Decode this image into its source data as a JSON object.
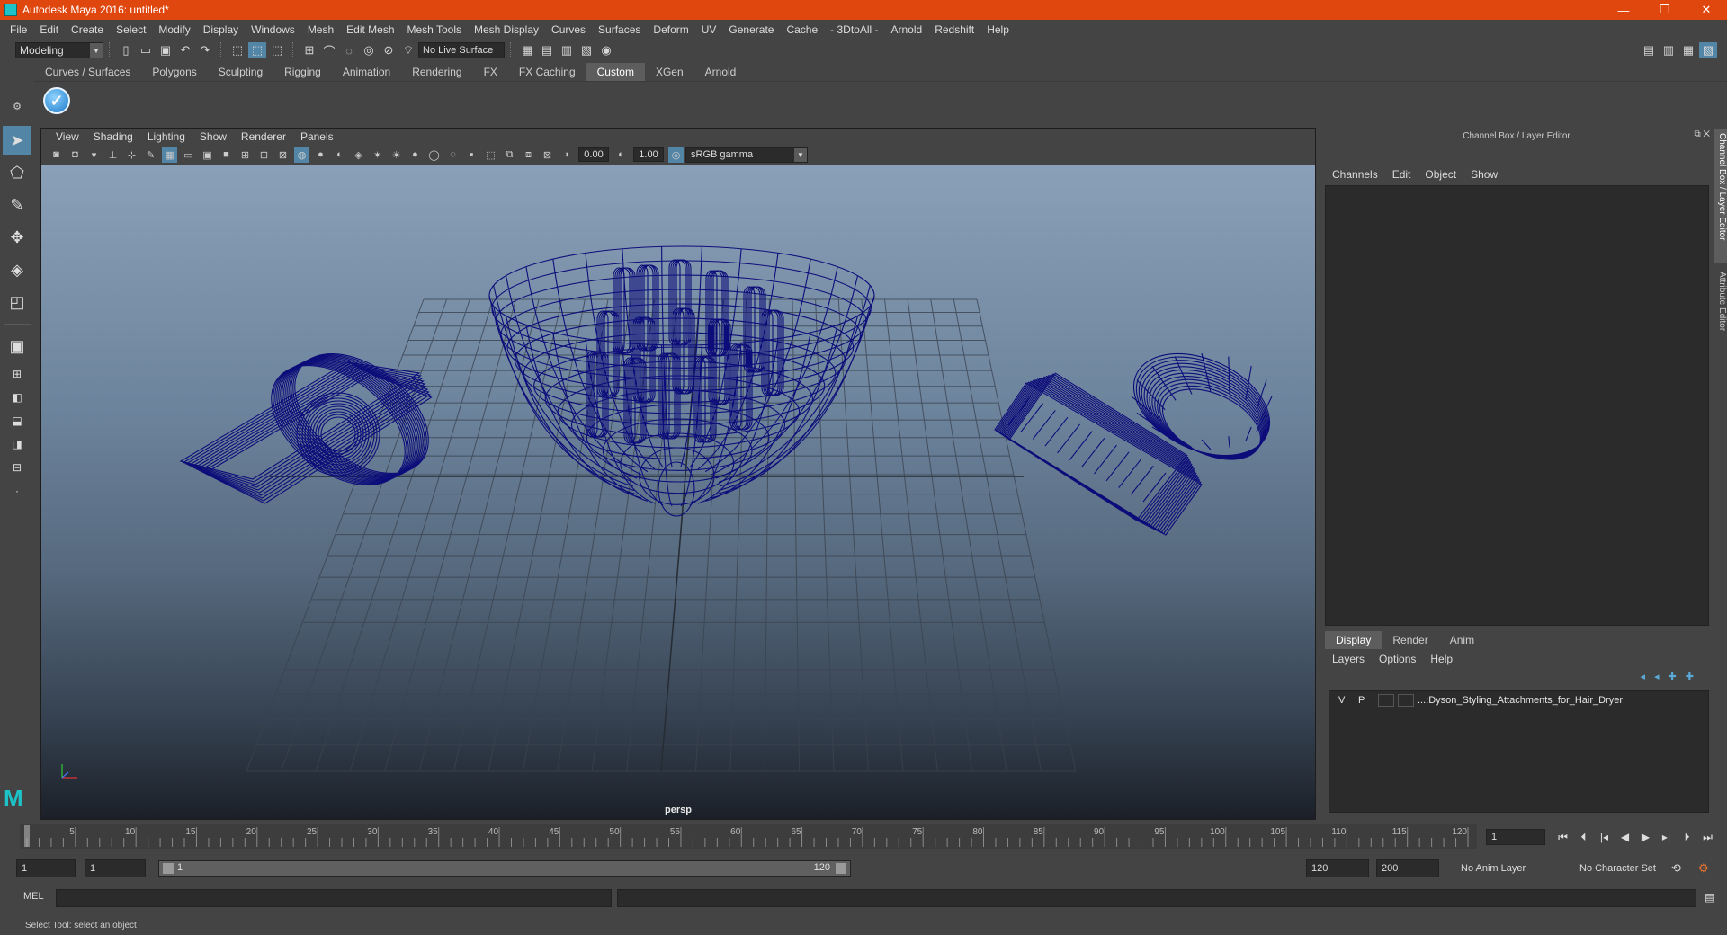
{
  "window": {
    "title": "Autodesk Maya 2016: untitled*",
    "buttons": [
      "—",
      "❐",
      "✕"
    ]
  },
  "menu": [
    "File",
    "Edit",
    "Create",
    "Select",
    "Modify",
    "Display",
    "Windows",
    "Mesh",
    "Edit Mesh",
    "Mesh Tools",
    "Mesh Display",
    "Curves",
    "Surfaces",
    "Deform",
    "UV",
    "Generate",
    "Cache",
    "- 3DtoAll -",
    "Arnold",
    "Redshift",
    "Help"
  ],
  "statusline": {
    "mode": "Modeling",
    "live_surface": "No Live Surface"
  },
  "shelf": {
    "tabs": [
      "Curves / Surfaces",
      "Polygons",
      "Sculpting",
      "Rigging",
      "Animation",
      "Rendering",
      "FX",
      "FX Caching",
      "Custom",
      "XGen",
      "Arnold"
    ],
    "active_tab": "Custom"
  },
  "viewport": {
    "menu": [
      "View",
      "Shading",
      "Lighting",
      "Show",
      "Renderer",
      "Panels"
    ],
    "exposure": "0.00",
    "gamma": "1.00",
    "color_space": "sRGB gamma",
    "camera": "persp",
    "wire_color": "#0d0d7a"
  },
  "channel_box": {
    "title": "Channel Box / Layer Editor",
    "menu": [
      "Channels",
      "Edit",
      "Object",
      "Show"
    ],
    "layer_tabs": [
      "Display",
      "Render",
      "Anim"
    ],
    "active_layer_tab": "Display",
    "layer_menu": [
      "Layers",
      "Options",
      "Help"
    ],
    "layer": {
      "v": "V",
      "p": "P",
      "name": "...:Dyson_Styling_Attachments_for_Hair_Dryer"
    },
    "side_tabs": [
      "Channel Box / Layer Editor",
      "Attribute Editor"
    ]
  },
  "timeline": {
    "start": 1,
    "end": 120,
    "major_every": 5,
    "current_frame": "1"
  },
  "range": {
    "start_time": "1",
    "playback_start": "1",
    "range_start_label": "1",
    "range_end_label": "120",
    "playback_end": "120",
    "end_time": "200",
    "anim_layer": "No Anim Layer",
    "character_set": "No Character Set"
  },
  "command": {
    "label": "MEL"
  },
  "help_line": "Select Tool: select an object"
}
